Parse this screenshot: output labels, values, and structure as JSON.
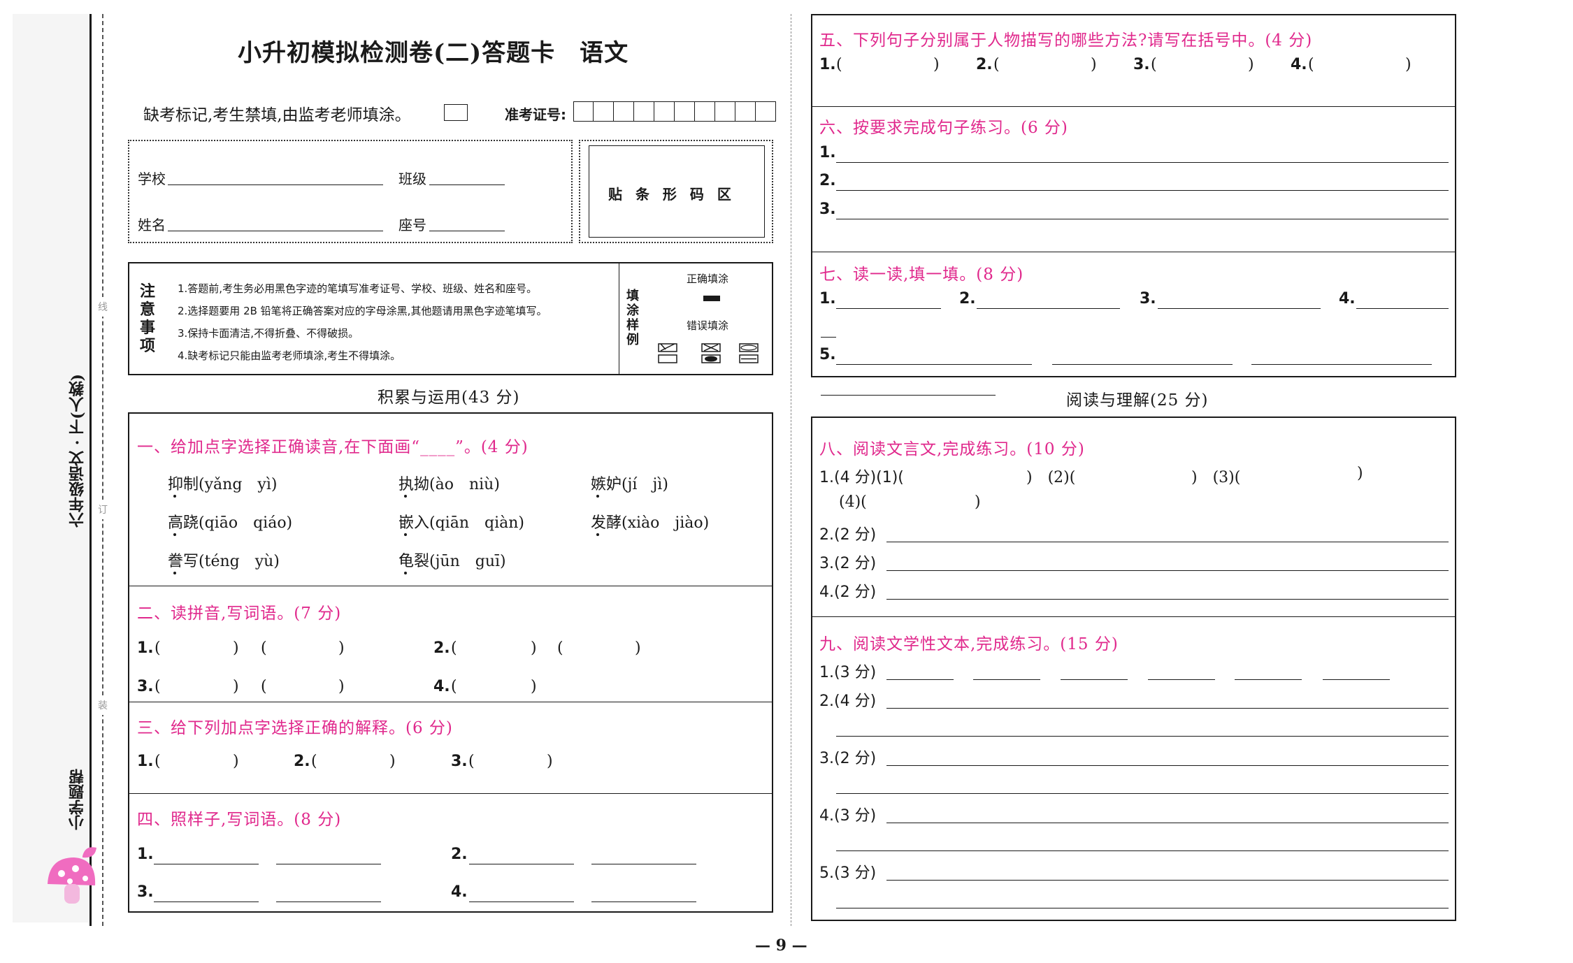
{
  "left": {
    "title": "小升初模拟检测卷(二)答题卡　语文",
    "absent_label": "缺考标记,考生禁填,由监考老师填涂。",
    "exam_id_label": "准考证号:",
    "school_label": "学校",
    "class_label": "班级",
    "name_label": "姓名",
    "seat_label": "座号",
    "barcode_label": "贴 条 形 码 区",
    "notes_title": "注意事项",
    "notes": [
      "1.答题前,考生务必用黑色字迹的笔填写准考证号、学校、班级、姓名和座号。",
      "2.选择题要用 2B 铅笔将正确答案对应的字母涂黑,其他题请用黑色字迹笔填写。",
      "3.保持卡面清洁,不得折叠、不得破损。",
      "4.缺考标记只能由监考老师填涂,考生不得填涂。"
    ],
    "fill_example_title": "填涂样例",
    "correct_fill": "正确填涂",
    "wrong_fill": "错误填涂",
    "part1_heading": "积累与运用(43 分)",
    "q1_title": "一、给加点字选择正确读音,在下面画“____”。(4 分)",
    "q1_items": [
      {
        "word": "抑制",
        "py": "(yǎng　yì)"
      },
      {
        "word": "执拗",
        "py": "(ào　niù)"
      },
      {
        "word": "嫉妒",
        "py": "(jí　jì)"
      },
      {
        "word": "高跷",
        "py": "(qiāo　qiáo)"
      },
      {
        "word": "嵌入",
        "py": "(qiān　qiàn)"
      },
      {
        "word": "发酵",
        "py": "(xiào　jiào)"
      },
      {
        "word": "誊写",
        "py": "(téng　yù)"
      },
      {
        "word": "龟裂",
        "py": "(jūn　guī)"
      }
    ],
    "q2_title": "二、读拼音,写词语。(7 分)",
    "q3_title": "三、给下列加点字选择正确的解释。(6 分)",
    "q4_title": "四、照样子,写词语。(8 分)",
    "n1": "1.",
    "n2": "2.",
    "n3": "3.",
    "n4": "4.",
    "n5": "5.",
    "paren_l": "(",
    "paren_r": ")"
  },
  "right": {
    "q5_title": "五、下列句子分别属于人物描写的哪些方法?请写在括号中。(4 分)",
    "q6_title": "六、按要求完成句子练习。(6 分)",
    "q7_title": "七、读一读,填一填。(8 分)",
    "part2_heading": "阅读与理解(25 分)",
    "q8_title": "八、阅读文言文,完成练习。(10 分)",
    "q8_items": {
      "i1": "1.(4 分)(1)(",
      "i1b": ")　(2)(",
      "i1c": ")　(3)(",
      "i1d": ")",
      "i1e": "(4)(",
      "i1f": ")",
      "i2": "2.(2 分)",
      "i3": "3.(2 分)",
      "i4": "4.(2 分)"
    },
    "q9_title": "九、阅读文学性文本,完成练习。(15 分)",
    "q9_items": {
      "i1": "1.(3 分)",
      "i2": "2.(4 分)",
      "i3": "3.(2 分)",
      "i4": "4.(3 分)",
      "i5": "5.(3 分)"
    }
  },
  "side": {
    "grade": "六年级语文 · 下(人教)",
    "brand": "小学题帮",
    "mark_line": "线",
    "mark_ding": "订",
    "mark_zhuang": "装"
  },
  "page_number": "— 9 —",
  "colors": {
    "accent": "#e0288c",
    "ink": "#1a1a1a"
  }
}
